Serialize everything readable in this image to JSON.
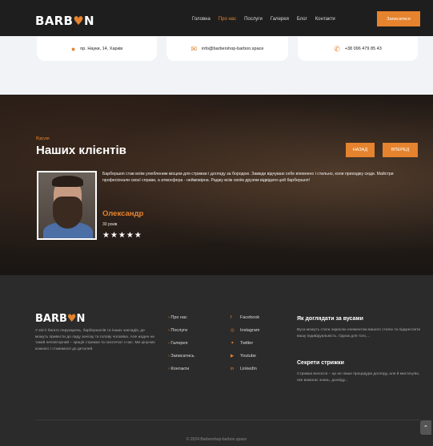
{
  "header": {
    "logo_left": "BARB",
    "logo_mark": "♥",
    "logo_right": "N",
    "nav": [
      "Головна",
      "Про нас",
      "Послуги",
      "Галерея",
      "Блог",
      "Контакти"
    ],
    "active_index": 1,
    "cta_label": "Записатися"
  },
  "contacts": {
    "address": "пр. Науки, 14, Харків",
    "email": "info@barbershop-barbon.space",
    "phone": "+38 096 479 85 43"
  },
  "hero": {
    "kicker": "Відгуки",
    "title": "Наших клієнтів",
    "prev_label": "НАЗАД",
    "next_label": "ВПЕРЕД",
    "quote": "Барбершоп став моїм улюбленим місцем для стрижки і догляду за бородою. Завжди відчуваю себе впевнено і стильно, коли приходжу сюди. Майстри професіонали своєї справи, а атмосфера - неймовірна. Раджу всім своїм друзям відвідати цей барбершоп!",
    "client_name": "Олександр",
    "client_age": "30 років",
    "stars": "★★★★★"
  },
  "footer": {
    "logo_left": "BARB",
    "logo_mark": "♥",
    "logo_right": "N",
    "about": "У місті багато перукарень, барбершопів та інших закладів, де можуть привести до ладу зачіску та голову чоловіка. Але жоден не такий неповторний – зрація стрижки та ганзтечат з нас. Ми цінуємо кожного і ставимося до деталей.",
    "links": [
      "Про нас",
      "Послуги",
      "Галерея",
      "Записатись",
      "Контакти"
    ],
    "social": [
      {
        "icon": "f",
        "label": "Facebook"
      },
      {
        "icon": "◎",
        "label": "Instagram"
      },
      {
        "icon": "✦",
        "label": "Twitter"
      },
      {
        "icon": "▶",
        "label": "Youtube"
      },
      {
        "icon": "in",
        "label": "LinkedIn"
      }
    ],
    "blog": [
      {
        "title": "Як доглядати за вусами",
        "text": "Вуса можуть стати окрасою елементом вашого стилю та підкреслити вашу індивідуальність. Однак для того,..."
      },
      {
        "title": "Секрети стрижки",
        "text": "Стрижка волосся – це не лише процедура догляду, але й мистецтво, яке вимагає знань, досвіду..."
      }
    ],
    "copyright": "© 2024 Barbershop-barbon.space",
    "to_top": "⌃"
  },
  "colors": {
    "accent": "#e5832e",
    "dark": "#1e1e1e",
    "footer": "#2b2b2b"
  }
}
